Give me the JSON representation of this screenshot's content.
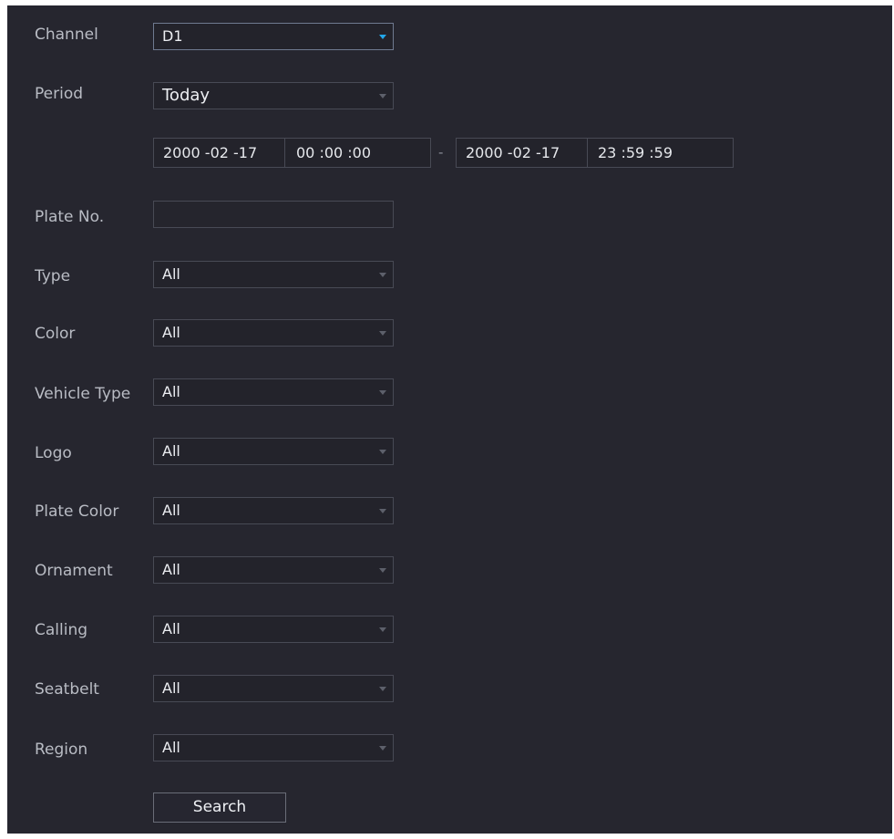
{
  "channel": {
    "label": "Channel",
    "value": "D1"
  },
  "period": {
    "label": "Period",
    "value": "Today",
    "start_date": "2000 -02 -17",
    "start_time": "00 :00 :00",
    "separator": "-",
    "end_date": "2000 -02 -17",
    "end_time": "23 :59 :59"
  },
  "plate_no": {
    "label": "Plate No.",
    "value": ""
  },
  "type": {
    "label": "Type",
    "value": "All"
  },
  "color": {
    "label": "Color",
    "value": "All"
  },
  "vehicle_type": {
    "label": "Vehicle Type",
    "value": "All"
  },
  "logo": {
    "label": "Logo",
    "value": "All"
  },
  "plate_color": {
    "label": "Plate Color",
    "value": "All"
  },
  "ornament": {
    "label": "Ornament",
    "value": "All"
  },
  "calling": {
    "label": "Calling",
    "value": "All"
  },
  "seatbelt": {
    "label": "Seatbelt",
    "value": "All"
  },
  "region": {
    "label": "Region",
    "value": "All"
  },
  "search_button": "Search",
  "colors": {
    "panel_bg": "#26262f",
    "field_border": "#484a55",
    "focus_arrow": "#23a7ea",
    "text": "#eceef2",
    "label_text": "#b9bcc4"
  }
}
